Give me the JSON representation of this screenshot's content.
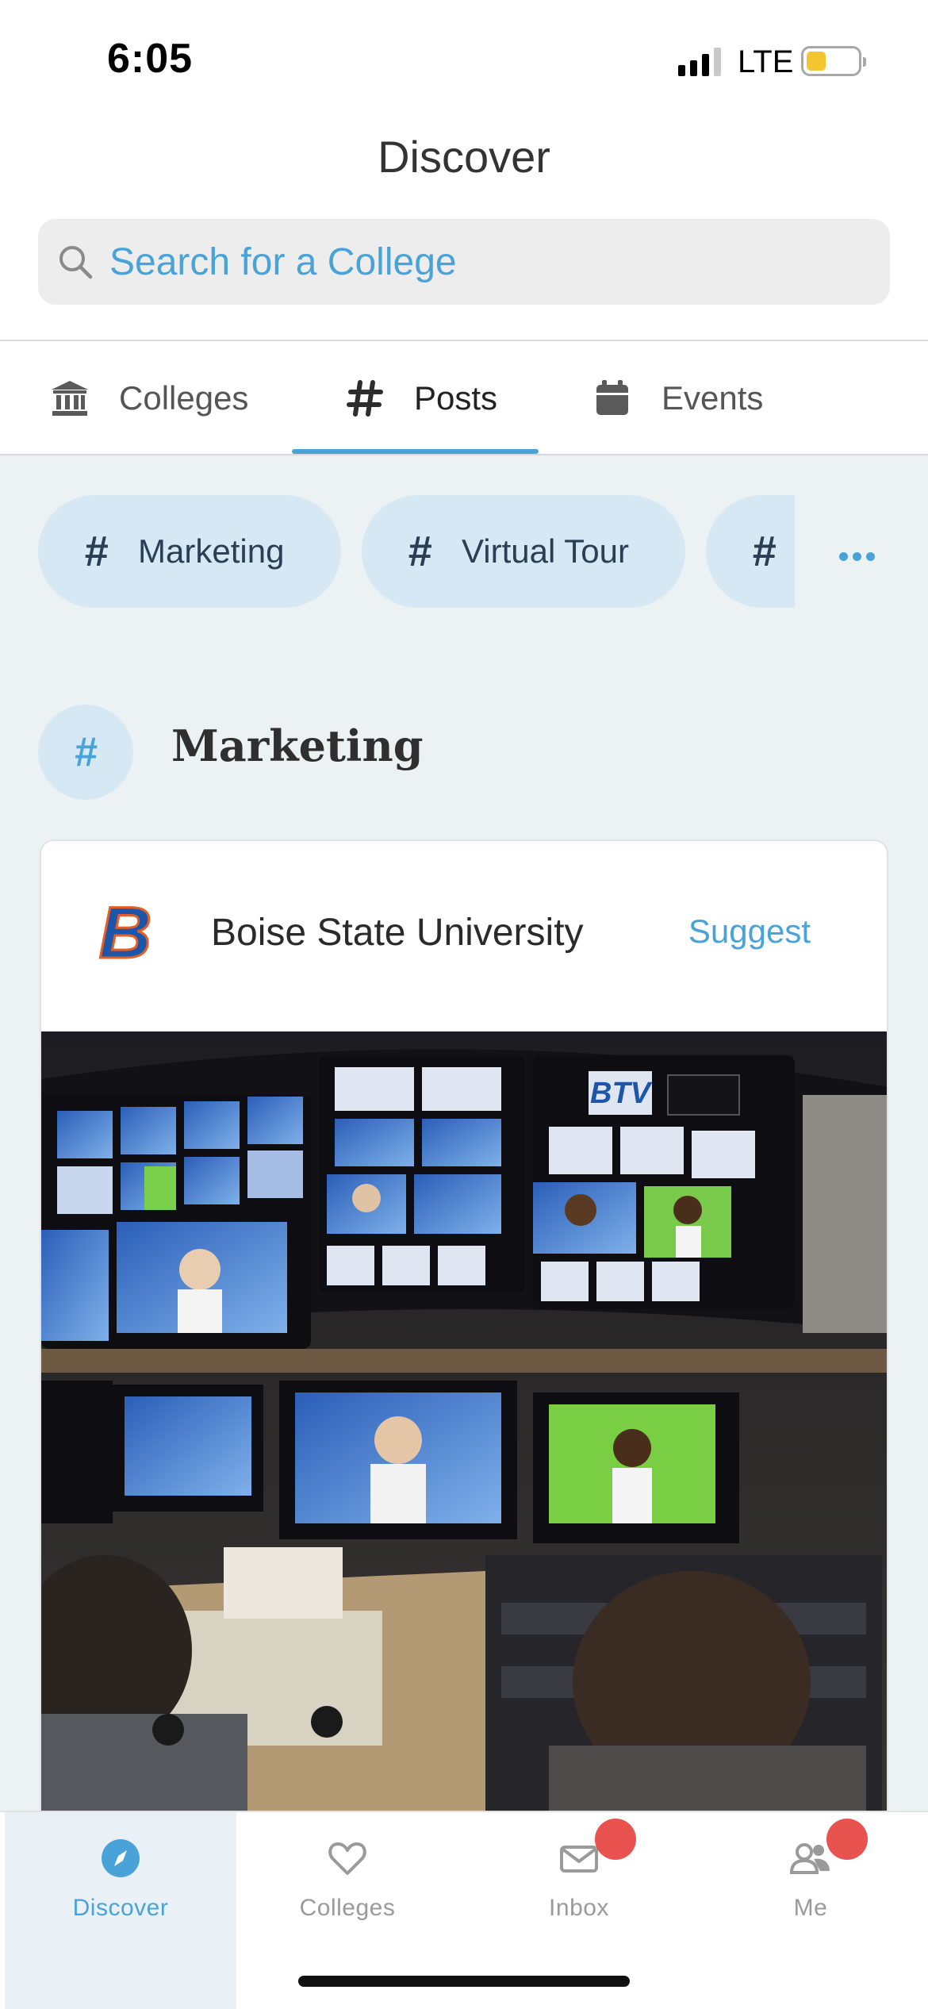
{
  "status_bar": {
    "time": "6:05",
    "network": "LTE",
    "battery_percent": 30
  },
  "header": {
    "title": "Discover",
    "search_placeholder": "Search for a College"
  },
  "tabs": [
    {
      "label": "Colleges",
      "icon": "bank-icon",
      "selected": false
    },
    {
      "label": "Posts",
      "icon": "hashtag-icon",
      "selected": true
    },
    {
      "label": "Events",
      "icon": "calendar-icon",
      "selected": false
    }
  ],
  "topic_chips": [
    {
      "label": "Marketing"
    },
    {
      "label": "Virtual Tour"
    },
    {
      "label": ""
    }
  ],
  "section": {
    "title": "Marketing"
  },
  "post": {
    "college": "Boise State University",
    "action": "Suggest",
    "logo_letter": "B",
    "photo_sign": "BTV"
  },
  "bottom_nav": [
    {
      "label": "Discover",
      "icon": "compass-icon",
      "active": true,
      "badge": false
    },
    {
      "label": "Colleges",
      "icon": "heart-icon",
      "active": false,
      "badge": false
    },
    {
      "label": "Inbox",
      "icon": "envelope-icon",
      "active": false,
      "badge": true
    },
    {
      "label": "Me",
      "icon": "people-icon",
      "active": false,
      "badge": true
    }
  ],
  "colors": {
    "accent": "#4aa3d8",
    "chip_bg": "#d5e8f3",
    "content_bg": "#ecf1f4",
    "badge": "#e8524f",
    "boise_blue": "#1d56a8",
    "boise_orange": "#e35f26"
  }
}
